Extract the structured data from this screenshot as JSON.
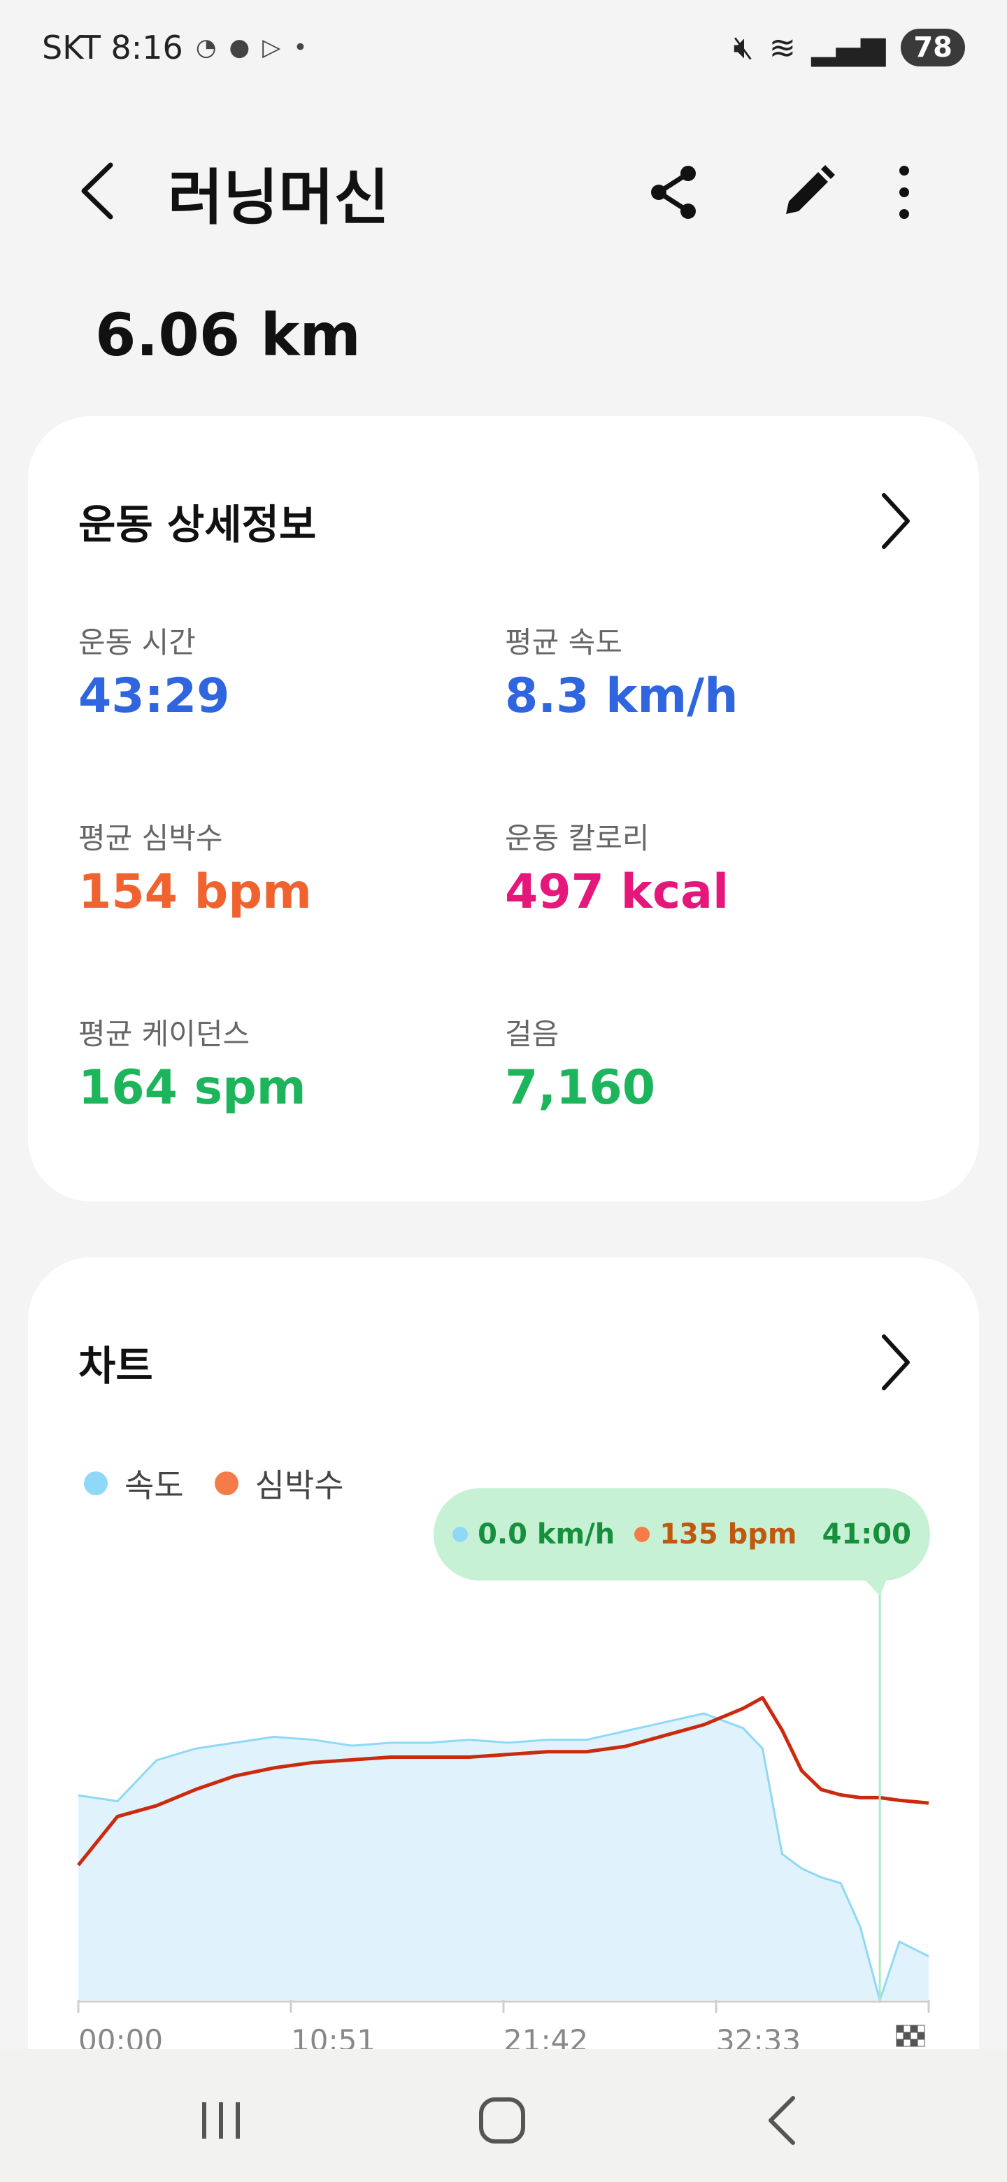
{
  "status": {
    "carrier_time": "SKT 8:16",
    "battery": "78"
  },
  "header": {
    "title": "러닝머신"
  },
  "distance": "6.06 km",
  "details": {
    "title": "운동 상세정보",
    "stats": [
      {
        "label": "운동 시간",
        "value": "43:29",
        "unit": "",
        "color": "#2f66e0"
      },
      {
        "label": "평균 속도",
        "value": "8.3",
        "unit": "km/h",
        "color": "#2f66e0"
      },
      {
        "label": "평균 심박수",
        "value": "154",
        "unit": "bpm",
        "color": "#f0622e"
      },
      {
        "label": "운동 칼로리",
        "value": "497",
        "unit": "kcal",
        "color": "#e6177a"
      },
      {
        "label": "평균 케이던스",
        "value": "164",
        "unit": "spm",
        "color": "#1db55c"
      },
      {
        "label": "걸음",
        "value": "7,160",
        "unit": "",
        "color": "#1db55c"
      }
    ]
  },
  "chart_card": {
    "title": "차트",
    "legend": [
      {
        "label": "속도",
        "color": "#8fd8f8"
      },
      {
        "label": "심박수",
        "color": "#f57c48"
      }
    ],
    "tooltip": {
      "speed": "0.0 km/h",
      "hr": "135 bpm",
      "time": "41:00"
    }
  },
  "chart_data": {
    "type": "area",
    "x": [
      0,
      2,
      4,
      6,
      8,
      10,
      12,
      14,
      16,
      18,
      20,
      22,
      24,
      26,
      28,
      30,
      32,
      34,
      35,
      36,
      37,
      38,
      39,
      40,
      41,
      42,
      43.5
    ],
    "x_tick_labels": [
      "00:00",
      "10:51",
      "21:42",
      "32:33"
    ],
    "series": [
      {
        "name": "속도",
        "color": "#8fd8f8",
        "fill": "#e0f3fc",
        "values": [
          7.0,
          6.8,
          8.2,
          8.6,
          8.8,
          9.0,
          8.9,
          8.7,
          8.8,
          8.8,
          8.9,
          8.8,
          8.9,
          8.9,
          9.2,
          9.5,
          9.8,
          9.3,
          8.6,
          5.0,
          4.5,
          4.2,
          4.0,
          2.5,
          0.0,
          2.0,
          1.5
        ]
      },
      {
        "name": "심박수",
        "color": "#cc2a0e",
        "values": [
          110,
          128,
          132,
          138,
          143,
          146,
          148,
          149,
          150,
          150,
          150,
          151,
          152,
          152,
          154,
          158,
          162,
          168,
          172,
          160,
          145,
          138,
          136,
          135,
          135,
          134,
          133
        ]
      }
    ],
    "xlim": [
      0,
      43.5
    ],
    "speed_ylim": [
      0,
      12
    ],
    "hr_ylim": [
      60,
      190
    ],
    "grid": false,
    "legend": "top-left"
  }
}
